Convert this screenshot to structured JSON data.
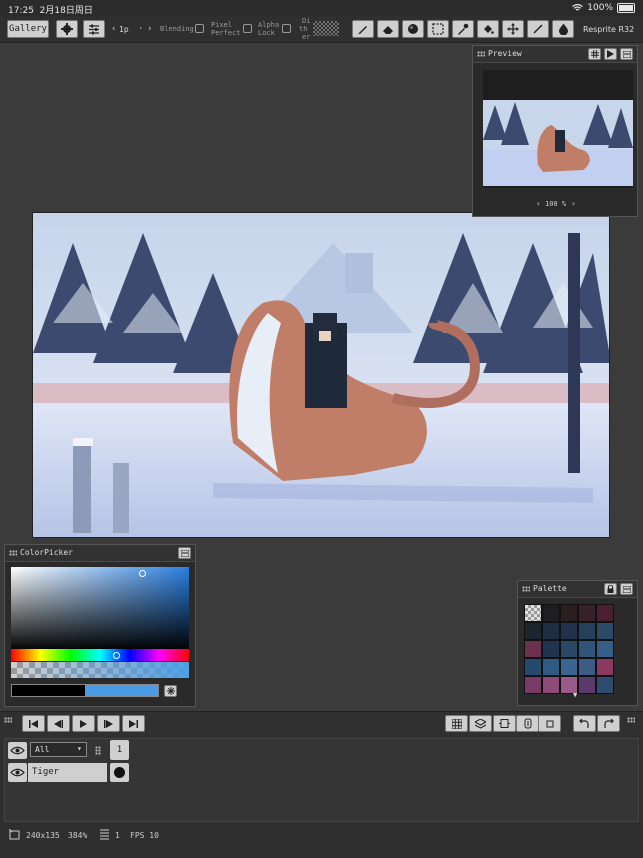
{
  "status": {
    "time": "17:25",
    "date": "2月18日周日",
    "battery": "100%"
  },
  "toolbar": {
    "gallery": "Gallery",
    "brush_size": "1p",
    "blending": "Blending",
    "pixel_perfect_1": "Pixel",
    "pixel_perfect_2": "Perfect",
    "alpha_lock_1": "Alpha",
    "alpha_lock_2": "Lock",
    "dither_1": "Di",
    "dither_2": "th",
    "dither_3": "er",
    "app_name": "Resprite R32"
  },
  "preview": {
    "title": "Preview",
    "zoom": "100 %"
  },
  "colorpicker": {
    "title": "ColorPicker"
  },
  "palette": {
    "title": "Palette",
    "swatches": [
      "#c8c8c8",
      "#1e1e22",
      "#2a1e1e",
      "#3a2028",
      "#4a1f30",
      "#1a2530",
      "#1e2d40",
      "#22324a",
      "#27405a",
      "#2c4a66",
      "#6a3050",
      "#1e3550",
      "#2a4868",
      "#2f5478",
      "#365e86",
      "#264a6e",
      "#2e5b84",
      "#3a6592",
      "#3e5a86",
      "#8a3a60",
      "#7a3a66",
      "#8e4a78",
      "#9a5a8a",
      "#5a3a6a",
      "#2c4c70"
    ]
  },
  "timeline": {
    "layer_filter": "All",
    "frame_number": "1",
    "layer_name": "Tiger"
  },
  "bottombar": {
    "canvas_size": "240x135",
    "zoom": "384%",
    "frame": "1",
    "fps": "FPS 10"
  }
}
